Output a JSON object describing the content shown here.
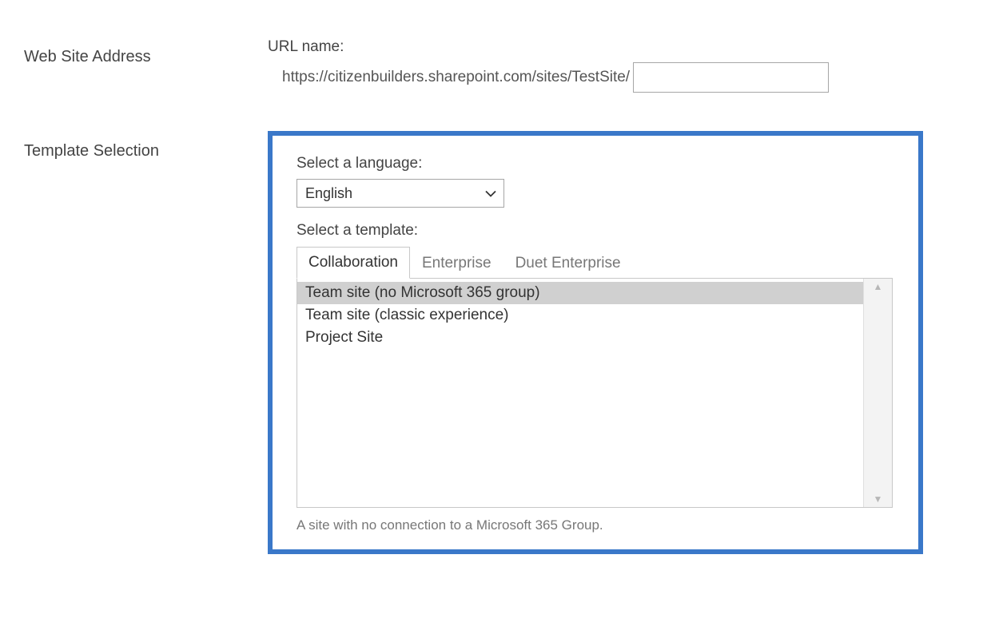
{
  "sections": {
    "address": {
      "heading": "Web Site Address",
      "url_name_label": "URL name:",
      "url_prefix": "https://citizenbuilders.sharepoint.com/sites/TestSite/",
      "url_value": ""
    },
    "template": {
      "heading": "Template Selection",
      "language_label": "Select a language:",
      "language_value": "English",
      "template_label": "Select a template:",
      "tabs": [
        {
          "label": "Collaboration"
        },
        {
          "label": "Enterprise"
        },
        {
          "label": "Duet Enterprise"
        }
      ],
      "items": [
        {
          "label": "Team site (no Microsoft 365 group)"
        },
        {
          "label": "Team site (classic experience)"
        },
        {
          "label": "Project Site"
        }
      ],
      "description": "A site with no connection to a Microsoft 365 Group.",
      "highlight_color": "#3a78c9"
    }
  }
}
